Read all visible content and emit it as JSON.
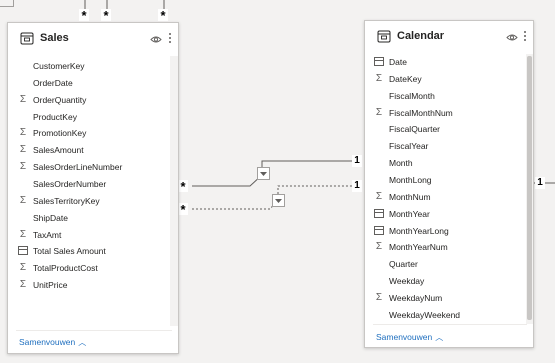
{
  "sales_table": {
    "title": "Sales",
    "collapse_label": "Samenvouwen",
    "fields": [
      {
        "label": "CustomerKey",
        "icon": "none"
      },
      {
        "label": "OrderDate",
        "icon": "none"
      },
      {
        "label": "OrderQuantity",
        "icon": "sigma"
      },
      {
        "label": "ProductKey",
        "icon": "none"
      },
      {
        "label": "PromotionKey",
        "icon": "sigma"
      },
      {
        "label": "SalesAmount",
        "icon": "sigma"
      },
      {
        "label": "SalesOrderLineNumber",
        "icon": "sigma"
      },
      {
        "label": "SalesOrderNumber",
        "icon": "none"
      },
      {
        "label": "SalesTerritoryKey",
        "icon": "sigma"
      },
      {
        "label": "ShipDate",
        "icon": "none"
      },
      {
        "label": "TaxAmt",
        "icon": "sigma"
      },
      {
        "label": "Total Sales Amount",
        "icon": "measure"
      },
      {
        "label": "TotalProductCost",
        "icon": "sigma"
      },
      {
        "label": "UnitPrice",
        "icon": "sigma"
      }
    ]
  },
  "calendar_table": {
    "title": "Calendar",
    "collapse_label": "Samenvouwen",
    "fields": [
      {
        "label": "Date",
        "icon": "calendar"
      },
      {
        "label": "DateKey",
        "icon": "sigma"
      },
      {
        "label": "FiscalMonth",
        "icon": "none"
      },
      {
        "label": "FiscalMonthNum",
        "icon": "sigma"
      },
      {
        "label": "FiscalQuarter",
        "icon": "none"
      },
      {
        "label": "FiscalYear",
        "icon": "none"
      },
      {
        "label": "Month",
        "icon": "none"
      },
      {
        "label": "MonthLong",
        "icon": "none"
      },
      {
        "label": "MonthNum",
        "icon": "sigma"
      },
      {
        "label": "MonthYear",
        "icon": "calendar"
      },
      {
        "label": "MonthYearLong",
        "icon": "calendar"
      },
      {
        "label": "MonthYearNum",
        "icon": "sigma"
      },
      {
        "label": "Quarter",
        "icon": "none"
      },
      {
        "label": "Weekday",
        "icon": "none"
      },
      {
        "label": "WeekdayNum",
        "icon": "sigma"
      },
      {
        "label": "WeekdayWeekend",
        "icon": "none"
      }
    ]
  },
  "relationship_markers": {
    "many": "*",
    "one": "1"
  },
  "colors": {
    "link": "#1f6fbf",
    "line": "#605e5c",
    "background": "#f3f2f1"
  }
}
